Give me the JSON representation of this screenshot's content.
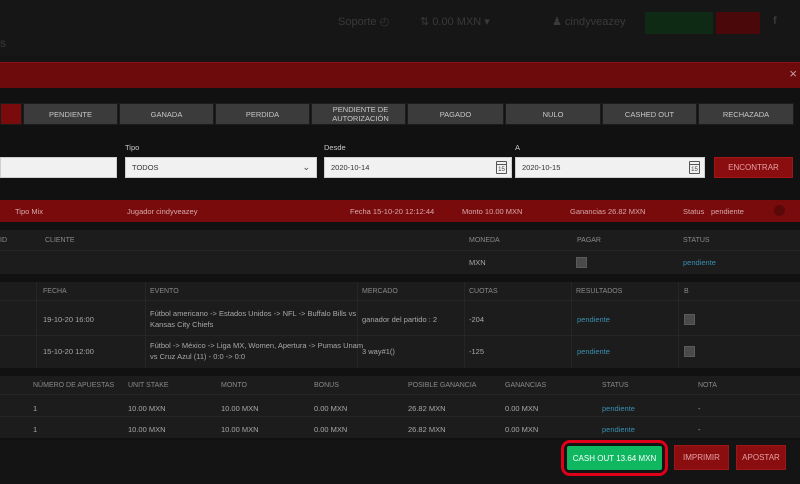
{
  "header": {
    "support": "Soporte",
    "balance": "0.00 MXN",
    "user": "cindyveazey",
    "colors": {
      "green_btn": "#0f2a14",
      "red_btn": "#4a080a"
    }
  },
  "breadcrumb_fragment": "s",
  "close_glyph": "×",
  "tabs": [
    {
      "label": "PENDIENTE"
    },
    {
      "label": "GANADA"
    },
    {
      "label": "PERDIDA"
    },
    {
      "label": "PENDIENTE DE AUTORIZACIÓN"
    },
    {
      "label": "PAGADO"
    },
    {
      "label": "NULO"
    },
    {
      "label": "CASHED OUT"
    },
    {
      "label": "RECHAZADA"
    }
  ],
  "filters": {
    "tipo_label": "Tipo",
    "tipo_value": "TODOS",
    "desde_label": "Desde",
    "desde_value": "2020-10-14",
    "a_label": "A",
    "a_value": "2020-10-15",
    "search_button": "ENCONTRAR"
  },
  "bet_summary": {
    "tipo": "Tipo  Mix",
    "jugador": "Jugador  cindyveazey",
    "fecha": "Fecha  15-10-20 12:12:44",
    "monto": "Monto  10.00 MXN",
    "ganancias": "Ganancias  26.82 MXN",
    "status_label": "Status",
    "status_value": "pendiente"
  },
  "client_table": {
    "headers": [
      "ID",
      "CLIENTE",
      "MONEDA",
      "PAGAR",
      "STATUS"
    ],
    "row": {
      "moneda": "MXN",
      "status": "pendiente"
    }
  },
  "events_table": {
    "headers": [
      "FECHA",
      "EVENTO",
      "MERCADO",
      "CUOTAS",
      "RESULTADOS",
      "B"
    ],
    "rows": [
      {
        "fecha": "19-10-20 16:00",
        "evento_l1": "Fútbol americano -> Estados Unidos -> NFL -> Buffalo Bills vs",
        "evento_l2": "Kansas City Chiefs",
        "mercado": "ganador del partido : 2",
        "cuotas": "-204",
        "resultado": "pendiente"
      },
      {
        "fecha": "15-10-20 12:00",
        "evento_l1": "Fútbol -> México -> Liga MX, Women, Apertura -> Pumas Unam",
        "evento_l2": "vs Cruz Azul (11) - 0:0 -> 0:0",
        "mercado": "3 way#1()",
        "cuotas": "-125",
        "resultado": "pendiente"
      }
    ]
  },
  "stakes_table": {
    "headers": [
      "NÚMERO DE APUESTAS",
      "UNIT STAKE",
      "MONTO",
      "BONUS",
      "POSIBLE GANANCIA",
      "GANANCIAS",
      "STATUS",
      "NOTA"
    ],
    "rows": [
      {
        "num": "1",
        "unit": "10.00 MXN",
        "monto": "10.00 MXN",
        "bonus": "0.00 MXN",
        "posible": "26.82 MXN",
        "ganancias": "0.00 MXN",
        "status": "pendiente",
        "nota": "-"
      },
      {
        "num": "1",
        "unit": "10.00 MXN",
        "monto": "10.00 MXN",
        "bonus": "0.00 MXN",
        "posible": "26.82 MXN",
        "ganancias": "0.00 MXN",
        "status": "pendiente",
        "nota": "-"
      }
    ]
  },
  "footer": {
    "cashout": "CASH OUT 13.64 MXN",
    "print": "IMPRIMIR",
    "bet": "APOSTAR"
  }
}
